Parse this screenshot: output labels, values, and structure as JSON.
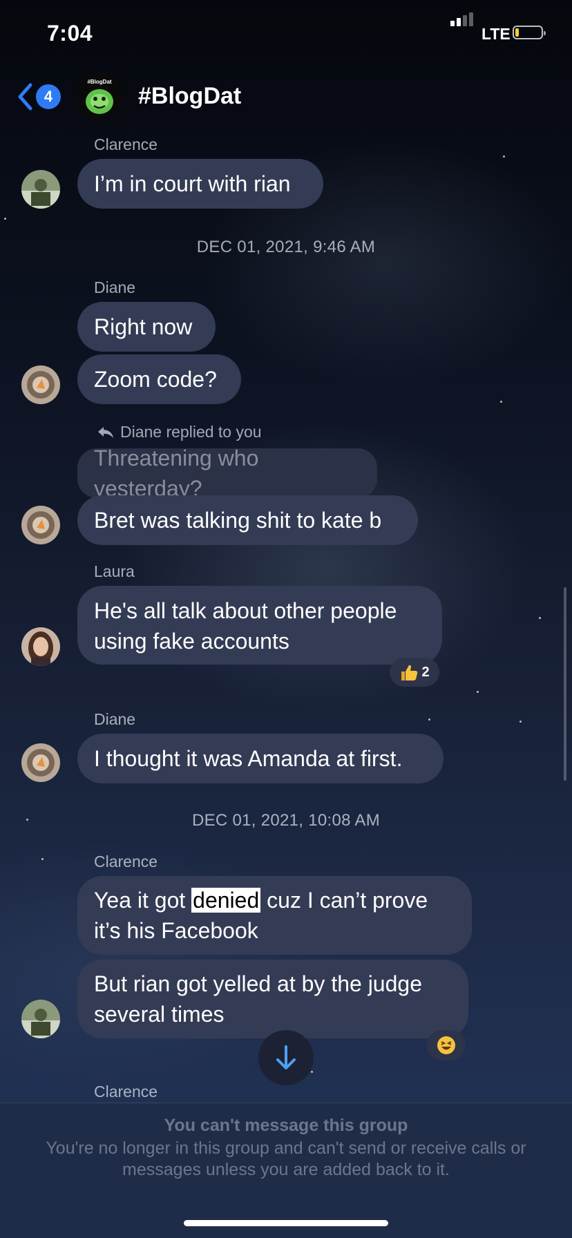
{
  "status_bar": {
    "time": "7:04",
    "network": "LTE",
    "battery_level": 0.1
  },
  "header": {
    "back_count": "4",
    "group_title": "#BlogDat",
    "avatar_text": "#BlogDat"
  },
  "messages": {
    "m1": {
      "sender": "Clarence",
      "text": "I’m in court with rian"
    },
    "ts1": "DEC 01, 2021, 9:46 AM",
    "m2": {
      "sender": "Diane",
      "text1": "Right now",
      "text2": "Zoom code?"
    },
    "m3": {
      "reply_label": "Diane replied to you",
      "quoted": "Threatening who yesterday?",
      "text": "Bret was talking shit to kate b"
    },
    "m4": {
      "sender": "Laura",
      "line1": "He's all talk about other people",
      "line2": "using fake accounts",
      "reaction_count": "2"
    },
    "m5": {
      "sender": "Diane",
      "text": "I thought it was Amanda at first."
    },
    "ts2": "DEC 01, 2021, 10:08 AM",
    "m6": {
      "sender": "Clarence",
      "l1a": "Yea it got ",
      "l1hl": "denied",
      "l1b": " cuz I can’t prove",
      "l2": "it’s his Facebook",
      "l3": "But rian got yelled at by the judge",
      "l4": "several times"
    },
    "m7": {
      "sender": "Clarence"
    }
  },
  "footer": {
    "title": "You can't message this group",
    "body": "You're no longer in this group and can't send or receive calls or messages unless you are added back to it."
  },
  "icons": {
    "back": "chevron-left-icon",
    "reply": "reply-arrow-icon",
    "thumbs_up": "thumbs-up-icon",
    "laughing": "laughing-emoji-icon",
    "scroll_down": "arrow-down-icon"
  },
  "colors": {
    "accent": "#2f7bf5",
    "bubble": "#343c55",
    "highlight": "#ffffff"
  }
}
